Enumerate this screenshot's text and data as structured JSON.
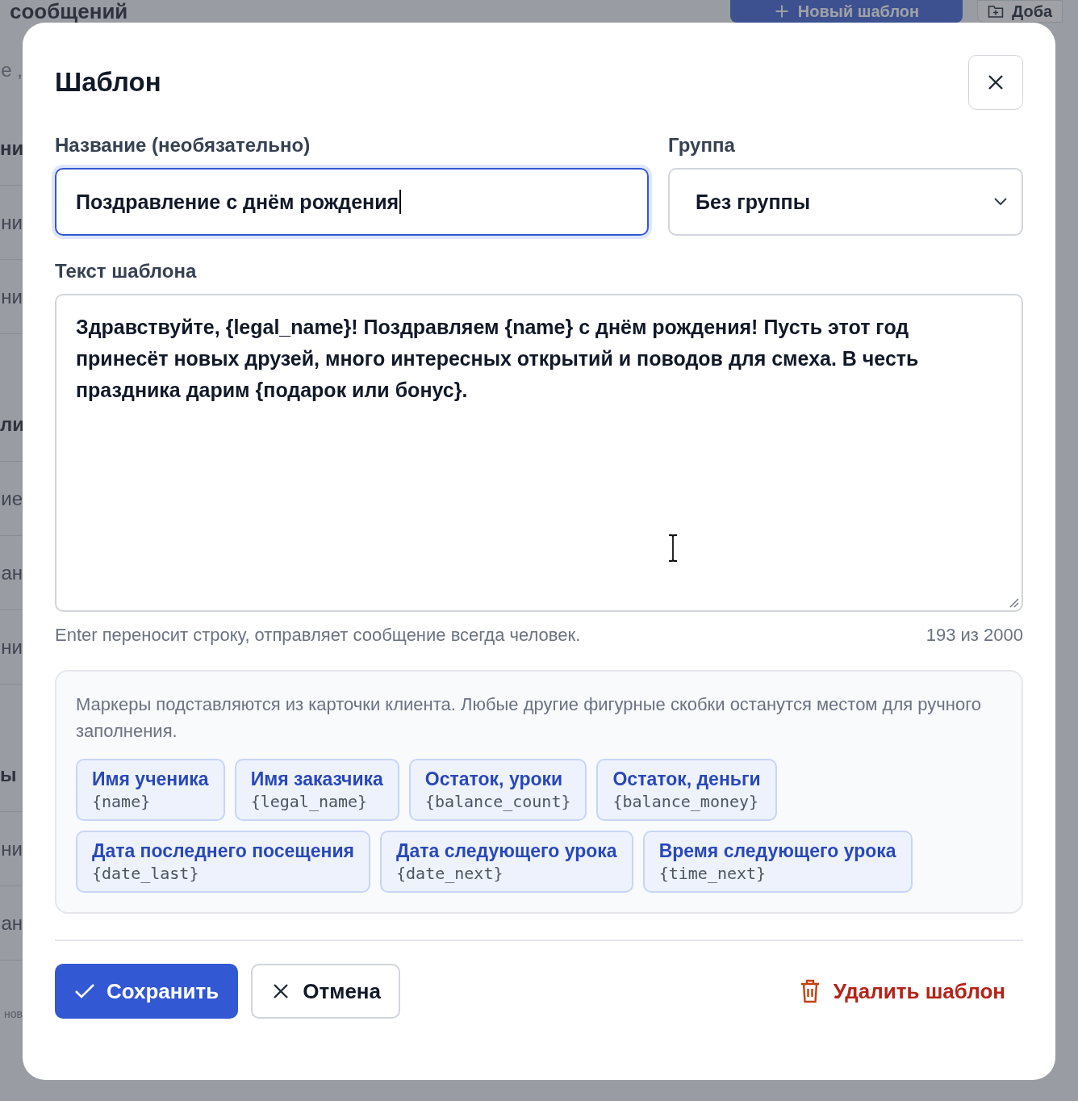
{
  "backdrop": {
    "title": "сообщений",
    "new_template_button": "Новый шаблон",
    "add_button": "Доба",
    "fragments": [
      {
        "kind": "subtitle",
        "text": "е ,"
      },
      {
        "kind": "heading",
        "text": "ни"
      },
      {
        "kind": "row",
        "text": "ни"
      },
      {
        "kind": "row",
        "text": "ни"
      },
      {
        "kind": "heading",
        "text": "ли"
      },
      {
        "kind": "row",
        "text": "ие"
      },
      {
        "kind": "row",
        "text": "ан"
      },
      {
        "kind": "row",
        "text": "ни"
      },
      {
        "kind": "heading",
        "text": "ы"
      },
      {
        "kind": "row",
        "text": "ни"
      },
      {
        "kind": "row",
        "text": "ан"
      },
      {
        "kind": "caption",
        "text": "нов"
      }
    ]
  },
  "dialog": {
    "title": "Шаблон",
    "name_field": {
      "label": "Название (необязательно)",
      "value": "Поздравление с днём рождения",
      "focused": true
    },
    "group_field": {
      "label": "Группа",
      "value": "Без группы"
    },
    "text_field": {
      "label": "Текст шаблона",
      "value": "Здравствуйте, {legal_name}! Поздравляем {name} с днём рождения! Пусть этот год принесёт новых друзей, много интересных открытий и поводов для смеха. В честь праздника дарим {подарок или бонус}."
    },
    "hint": "Enter переносит строку, отправляет сообщение всегда человек.",
    "counter": "193 из 2000",
    "markers": {
      "description": "Маркеры подставляются из карточки клиента. Любые другие фигурные скобки останутся местом для ручного заполнения.",
      "items": [
        {
          "label": "Имя ученика",
          "code": "{name}"
        },
        {
          "label": "Имя заказчика",
          "code": "{legal_name}"
        },
        {
          "label": "Остаток, уроки",
          "code": "{balance_count}"
        },
        {
          "label": "Остаток, деньги",
          "code": "{balance_money}"
        },
        {
          "label": "Дата последнего посещения",
          "code": "{date_last}"
        },
        {
          "label": "Дата следующего урока",
          "code": "{date_next}"
        },
        {
          "label": "Время следующего урока",
          "code": "{time_next}"
        }
      ]
    },
    "buttons": {
      "save": "Сохранить",
      "cancel": "Отмена",
      "delete": "Удалить шаблон"
    }
  }
}
